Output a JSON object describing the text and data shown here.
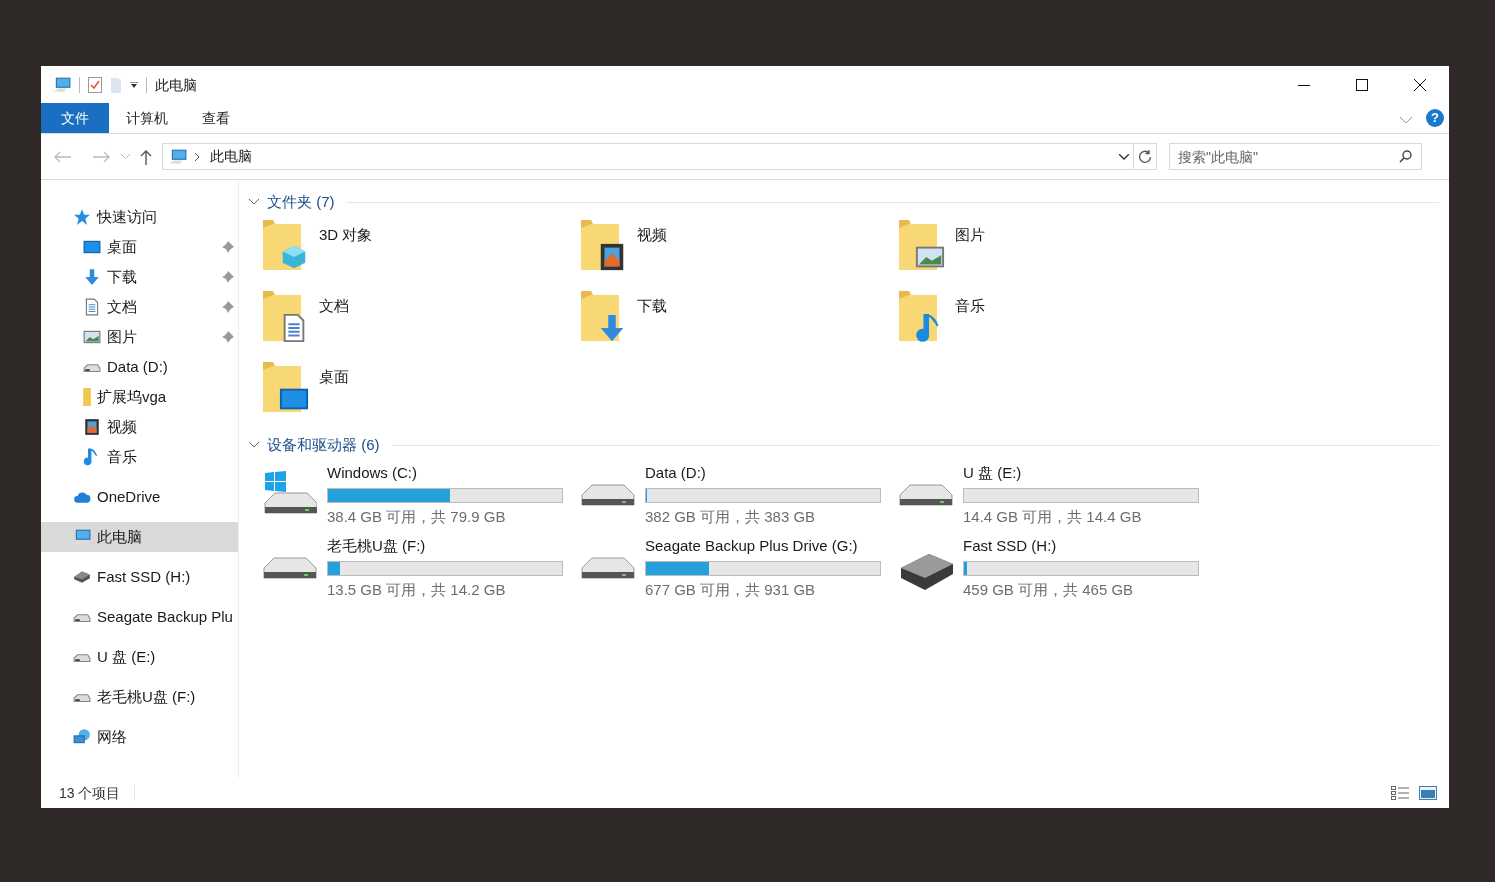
{
  "window": {
    "title": "此电脑"
  },
  "ribbon": {
    "help": "?",
    "tabs": [
      {
        "label": "文件",
        "selected": true
      },
      {
        "label": "计算机",
        "selected": false
      },
      {
        "label": "查看",
        "selected": false
      }
    ]
  },
  "address_bar": {
    "path": "此电脑"
  },
  "search": {
    "placeholder": "搜索\"此电脑\""
  },
  "navigation": [
    {
      "label": "快速访问",
      "kind": "star",
      "selected": false,
      "children": [
        {
          "label": "桌面",
          "kind": "desktop",
          "pinned": true
        },
        {
          "label": "下载",
          "kind": "download",
          "pinned": true
        },
        {
          "label": "文档",
          "kind": "document",
          "pinned": true
        },
        {
          "label": "图片",
          "kind": "picture",
          "pinned": true
        },
        {
          "label": "Data (D:)",
          "kind": "drive",
          "pinned": false
        },
        {
          "label": "扩展坞vga",
          "kind": "folder",
          "pinned": false
        },
        {
          "label": "视频",
          "kind": "video",
          "pinned": false
        },
        {
          "label": "音乐",
          "kind": "music",
          "pinned": false
        }
      ]
    },
    {
      "label": "OneDrive",
      "kind": "cloud",
      "selected": false
    },
    {
      "label": "此电脑",
      "kind": "pc",
      "selected": true
    },
    {
      "label": "Fast SSD (H:)",
      "kind": "ssd",
      "selected": false
    },
    {
      "label": "Seagate Backup Plu",
      "kind": "drive",
      "selected": false
    },
    {
      "label": "U 盘 (E:)",
      "kind": "drive",
      "selected": false
    },
    {
      "label": "老毛桃U盘 (F:)",
      "kind": "drive",
      "selected": false
    },
    {
      "label": "网络",
      "kind": "network",
      "selected": false
    }
  ],
  "folders": {
    "heading": "文件夹 (7)",
    "expanded": true,
    "items": [
      {
        "label": "3D 对象",
        "kind": "cube"
      },
      {
        "label": "视频",
        "kind": "video"
      },
      {
        "label": "图片",
        "kind": "picture"
      },
      {
        "label": "文档",
        "kind": "document"
      },
      {
        "label": "下载",
        "kind": "download"
      },
      {
        "label": "音乐",
        "kind": "music"
      },
      {
        "label": "桌面",
        "kind": "desktop"
      }
    ]
  },
  "drives": {
    "heading": "设备和驱动器 (6)",
    "expanded": true,
    "items": [
      {
        "label": "Windows (C:)",
        "kind": "system",
        "level": 0.52,
        "space": "38.4 GB 可用，共 79.9 GB"
      },
      {
        "label": "Data (D:)",
        "kind": "drive",
        "level": 0.003,
        "space": "382 GB 可用，共 383 GB"
      },
      {
        "label": "U 盘 (E:)",
        "kind": "drive",
        "level": 0,
        "space": "14.4 GB 可用，共 14.4 GB"
      },
      {
        "label": "老毛桃U盘 (F:)",
        "kind": "drive",
        "level": 0.05,
        "space": "13.5 GB 可用，共 14.2 GB"
      },
      {
        "label": "Seagate Backup Plus Drive (G:)",
        "kind": "drive",
        "level": 0.27,
        "space": "677 GB 可用，共 931 GB"
      },
      {
        "label": "Fast SSD (H:)",
        "kind": "ssd",
        "level": 0.013,
        "space": "459 GB 可用，共 465 GB"
      }
    ]
  },
  "status_bar": {
    "count": "13 个项目"
  }
}
